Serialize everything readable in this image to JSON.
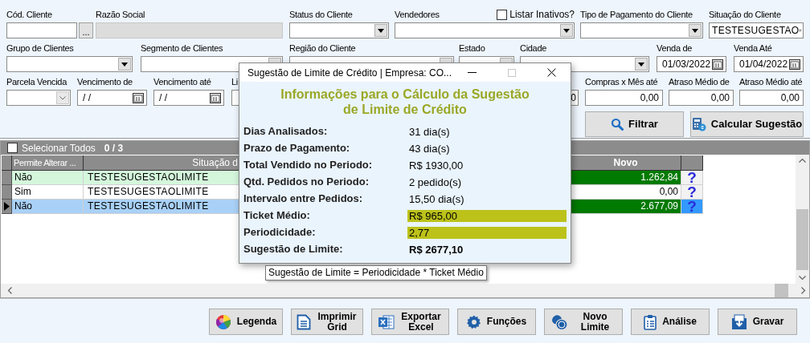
{
  "filters": [
    {
      "label": "Cód. Cliente",
      "kind": "text",
      "disabled": false
    },
    {
      "label": "Razão Social",
      "kind": "text",
      "disabled": true
    },
    {
      "label": "Status do Cliente",
      "kind": "dropdown",
      "disabled": false
    },
    {
      "label": "Vendedores",
      "kind": "dropdown",
      "disabled": false
    },
    {
      "label": "Tipo de Pagamento do Cliente",
      "kind": "dropdown",
      "disabled": false
    },
    {
      "label": "Situação do Cliente",
      "kind": "dropdown",
      "value": "TESTESUGESTAO",
      "disabled": false
    },
    {
      "label": "Grupo de Clientes",
      "kind": "dropdown",
      "disabled": false
    },
    {
      "label": "Segmento de Clientes",
      "kind": "dropdown",
      "disabled": false
    },
    {
      "label": "Região do Cliente",
      "kind": "dropdown",
      "disabled": false
    },
    {
      "label": "Estado",
      "kind": "dropdown",
      "disabled": false
    },
    {
      "label": "Cidade",
      "kind": "dropdown",
      "disabled": false
    },
    {
      "label": "Venda de",
      "kind": "date",
      "value": "01/03/2022",
      "disabled": false
    },
    {
      "label": "Venda Até",
      "kind": "date",
      "value": "01/04/2022",
      "disabled": false
    },
    {
      "label": "Parcela Vencida",
      "kind": "select",
      "disabled": false
    },
    {
      "label": "Vencimento de",
      "kind": "date",
      "value": "/ /",
      "disabled": false
    },
    {
      "label": "Vencimento até",
      "kind": "date",
      "value": "/ /",
      "disabled": false
    },
    {
      "label": "Li",
      "kind": "text",
      "value": "0",
      "disabled": false
    },
    {
      "label": "Compras x Mês até",
      "kind": "text",
      "value": "0,00",
      "disabled": false
    },
    {
      "label": "Atraso Médio de",
      "kind": "text",
      "value": "0,00",
      "disabled": false
    },
    {
      "label": "Atraso Médio até",
      "kind": "text",
      "value": "0,00",
      "disabled": false
    }
  ],
  "lookup_button": "...",
  "list_inactive": {
    "label": "Listar Inativos?",
    "checked": false
  },
  "actions": [
    "Filtrar",
    "Calcular Sugestão"
  ],
  "grid": {
    "select_all": {
      "label": "Selecionar Todos",
      "checked": false
    },
    "count": "0 / 3",
    "columns": [
      "Permite Alterar ...",
      "Situação d",
      "Novo"
    ],
    "rows": [
      {
        "permite": "Não",
        "situacao": "TESTESUGESTAOLIMITE",
        "novo": "1.262,84",
        "help": "?",
        "color": "#d4f7dc",
        "highlight": true,
        "selected": false
      },
      {
        "permite": "Sim",
        "situacao": "TESTESUGESTAOLIMITE",
        "novo": "0,00",
        "help": "?",
        "color": "#ffffff",
        "highlight": false,
        "selected": false
      },
      {
        "permite": "Não",
        "situacao": "TESTESUGESTAOLIMITE",
        "novo": "2.677,09",
        "help": "?",
        "color": "#a9d1f7",
        "highlight": true,
        "selected": true
      }
    ]
  },
  "buttons": [
    "Legenda",
    "Imprimir Grid",
    "Exportar Excel",
    "Funções",
    "Novo Limite",
    "Análise",
    "Gravar"
  ],
  "dialog": {
    "title": "Sugestão de Limite de Crédito | Empresa: CO...",
    "heading": "Informações para o Cálculo da Sugestão de Limite de Crédito",
    "rows": [
      {
        "label": "Dias Analisados:",
        "value": "31 dia(s)",
        "highlighted": false,
        "bold": false
      },
      {
        "label": "Prazo de Pagamento:",
        "value": "43 dia(s)",
        "highlighted": false,
        "bold": false
      },
      {
        "label": "Total Vendido no Periodo:",
        "value": "R$ 1930,00",
        "highlighted": false,
        "bold": false
      },
      {
        "label": "Qtd. Pedidos no Periodo:",
        "value": "2 pedido(s)",
        "highlighted": false,
        "bold": false
      },
      {
        "label": "Intervalo entre Pedidos:",
        "value": "15,50 dia(s)",
        "highlighted": false,
        "bold": false
      },
      {
        "label": "Ticket Médio:",
        "value": "R$ 965,00",
        "highlighted": true,
        "bold": false
      },
      {
        "label": "Periodicidade:",
        "value": "2,77",
        "highlighted": true,
        "bold": false
      },
      {
        "label": "Sugestão de Limite:",
        "value": "R$ 2677,10",
        "highlighted": false,
        "bold": true
      }
    ]
  },
  "tooltip": "Sugestão de Limite = Periodicidade * Ticket Médio"
}
